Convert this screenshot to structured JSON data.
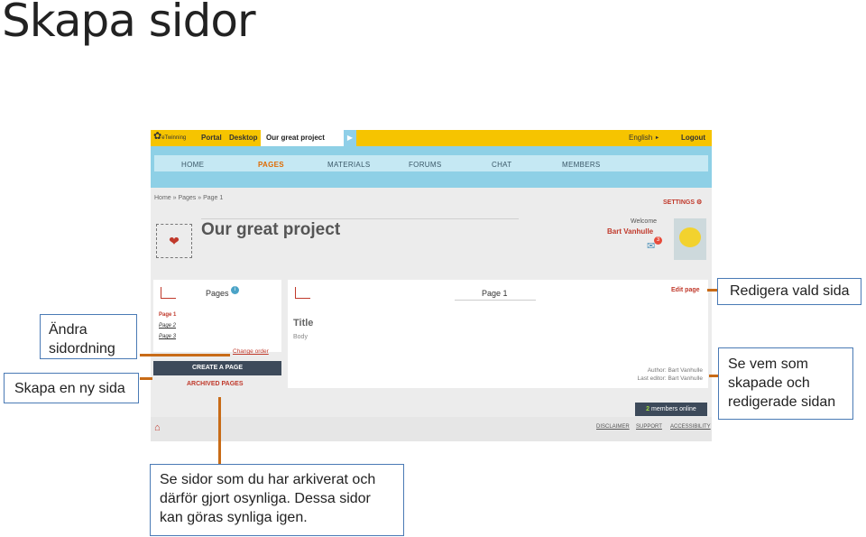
{
  "slide": {
    "title": "Skapa sidor"
  },
  "app": {
    "topbar": {
      "portal": "Portal",
      "desktop": "Desktop",
      "project_tab": "Our great project",
      "language": "English",
      "logout": "Logout",
      "logo_text": "eTwinning"
    },
    "nav": [
      "HOME",
      "PAGES",
      "MATERIALS",
      "FORUMS",
      "CHAT",
      "MEMBERS"
    ],
    "nav_active": "PAGES",
    "breadcrumb": "Home  »  Pages  »  Page 1",
    "settings": "SETTINGS",
    "project_title": "Our great project",
    "welcome": "Welcome",
    "username": "Bart Vanhulle",
    "message_count": "3",
    "pages_panel": {
      "title": "Pages",
      "items": [
        "Page 1",
        "Page 2",
        "Page 3"
      ],
      "change_order": "Change order",
      "create_button": "CREATE A PAGE",
      "archived": "ARCHIVED PAGES"
    },
    "content": {
      "page_title": "Page 1",
      "edit_page": "Edit page",
      "title": "Title",
      "body": "Body",
      "author": "Author: Bart Vanhulle",
      "last_editor": "Last editor: Bart Vanhulle"
    },
    "members_online": {
      "count": "2",
      "label": "members online"
    },
    "footer": [
      "DISCLAIMER",
      "SUPPORT",
      "ACCESSIBILITY"
    ]
  },
  "callouts": {
    "reorder": "Ändra sidordning",
    "create": "Skapa en ny sida",
    "edit": "Redigera vald sida",
    "who": "Se vem som skapade och redigerade sidan",
    "archived": "Se sidor som du har arkiverat och därför gjort osynliga. Dessa sidor kan göras synliga igen."
  },
  "colors": {
    "accent": "#c86b17",
    "callout_border": "#4a7ab5",
    "topbar": "#f6c400",
    "nav": "#8ed0e6"
  }
}
